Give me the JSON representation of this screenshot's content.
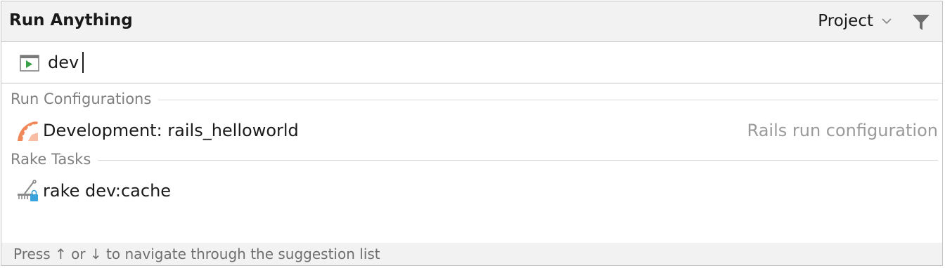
{
  "header": {
    "title": "Run Anything",
    "scope_label": "Project",
    "icons": {
      "scope_dropdown": "chevron-down-icon",
      "filter": "filter-icon"
    }
  },
  "search": {
    "value": "dev",
    "icon": "run-configuration-icon"
  },
  "sections": [
    {
      "label": "Run Configurations",
      "items": [
        {
          "label": "Development: rails_helloworld",
          "hint": "Rails run configuration",
          "icon": "rails-icon"
        }
      ]
    },
    {
      "label": "Rake Tasks",
      "items": [
        {
          "label": "rake dev:cache",
          "hint": "",
          "icon": "rake-icon"
        }
      ]
    }
  ],
  "footer": {
    "hint": "Press ↑ or ↓ to navigate through the suggestion list"
  },
  "colors": {
    "header_bg": "#f2f2f2",
    "rails_accent": "#f0895a",
    "run_icon_green": "#3aa146",
    "rake_accent": "#3ba3dc"
  }
}
